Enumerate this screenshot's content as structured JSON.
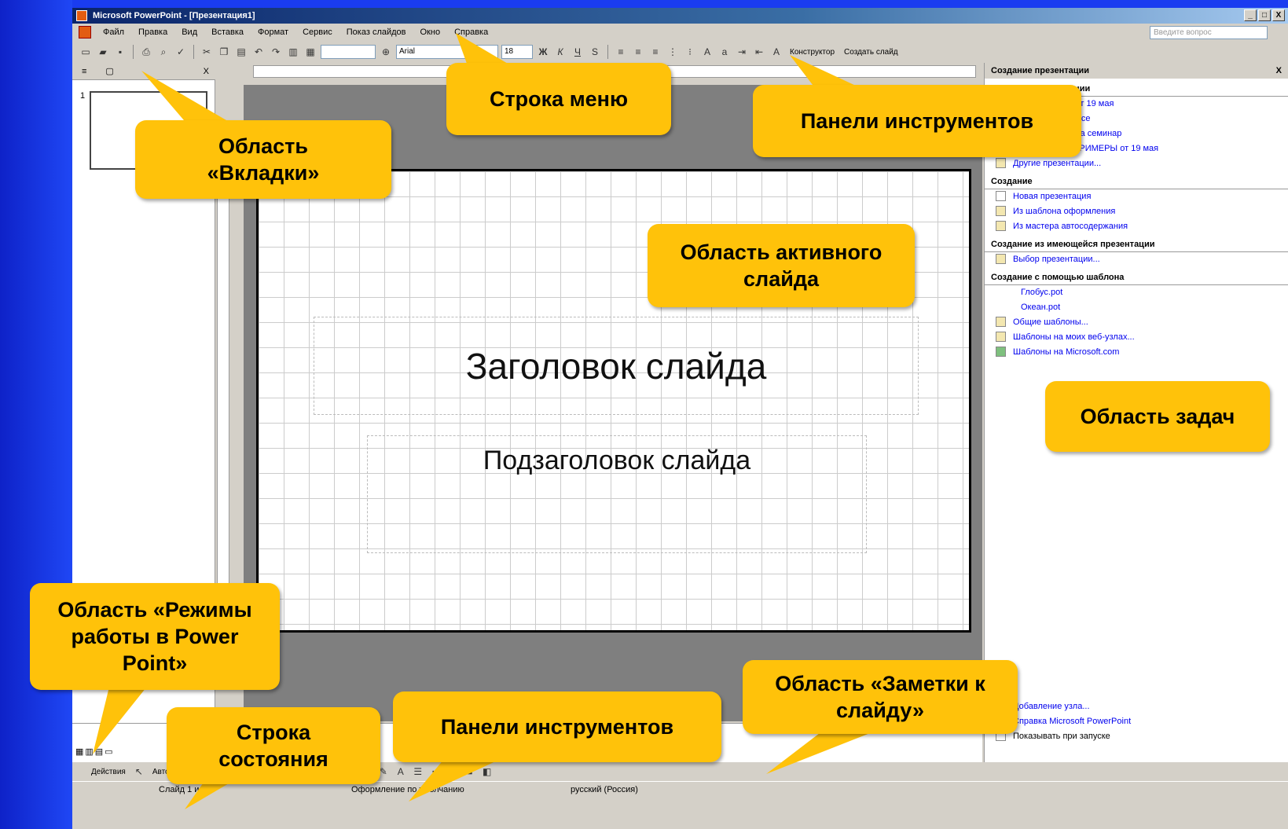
{
  "window": {
    "title": "Microsoft PowerPoint - [Презентация1]",
    "buttons": [
      "_",
      "□",
      "X"
    ]
  },
  "menu": {
    "items": [
      "Файл",
      "Правка",
      "Вид",
      "Вставка",
      "Формат",
      "Сервис",
      "Показ слайдов",
      "Окно",
      "Справка"
    ],
    "ask_placeholder": "Введите вопрос"
  },
  "toolbar": {
    "font": "Arial",
    "size": "18",
    "designer": "Конструктор",
    "new_slide": "Создать слайд"
  },
  "tabs": {
    "outline_icon": "≡",
    "slides_icon": "▢",
    "close": "X"
  },
  "thumbnail": {
    "number": "1"
  },
  "slide": {
    "title": "Заголовок слайда",
    "subtitle": "Подзаголовок слайда"
  },
  "taskpane": {
    "title": "Создание презентации",
    "close": "X",
    "sections": {
      "open": "Открытие презентации",
      "create": "Создание",
      "from_existing": "Создание из имеющейся презентации",
      "from_template": "Создание с помощью шаблона"
    },
    "open_items": [
      "Презентация от 19 мая",
      "Тема Effect Office",
      "Презентация на семинар",
      "ПрезентацияПРИМЕРЫ от 19 мая",
      "Другие презентации..."
    ],
    "create_items": [
      "Новая презентация",
      "Из шаблона оформления",
      "Из мастера автосодержания"
    ],
    "existing_items": [
      "Выбор презентации..."
    ],
    "template_items": [
      "Глобус.pot",
      "Океан.pot",
      "Общие шаблоны...",
      "Шаблоны на моих веб-узлах...",
      "Шаблоны на Microsoft.com"
    ],
    "bottom_items": [
      "Добавление узла...",
      "Справка Microsoft PowerPoint",
      "Показывать при запуске"
    ]
  },
  "drawbar": {
    "actions": "Действия",
    "autoshapes": "Автофигуры"
  },
  "statusbar": {
    "slide": "Слайд 1 из 1",
    "design": "Оформление по умолчанию",
    "lang": "русский (Россия)"
  },
  "callouts": {
    "menu": "Строка меню",
    "toolbars_top": "Панели инструментов",
    "tabs": "Область «Вкладки»",
    "active_slide": "Область активного слайда",
    "taskpane": "Область задач",
    "view_modes": "Область «Режимы работы в Power Point»",
    "status": "Строка состояния",
    "toolbars_bottom": "Панели инструментов",
    "notes": "Область «Заметки к слайду»"
  },
  "colors": {
    "callout": "#ffc20a",
    "background": "#1a3cf0",
    "window": "#d4d0c8"
  }
}
